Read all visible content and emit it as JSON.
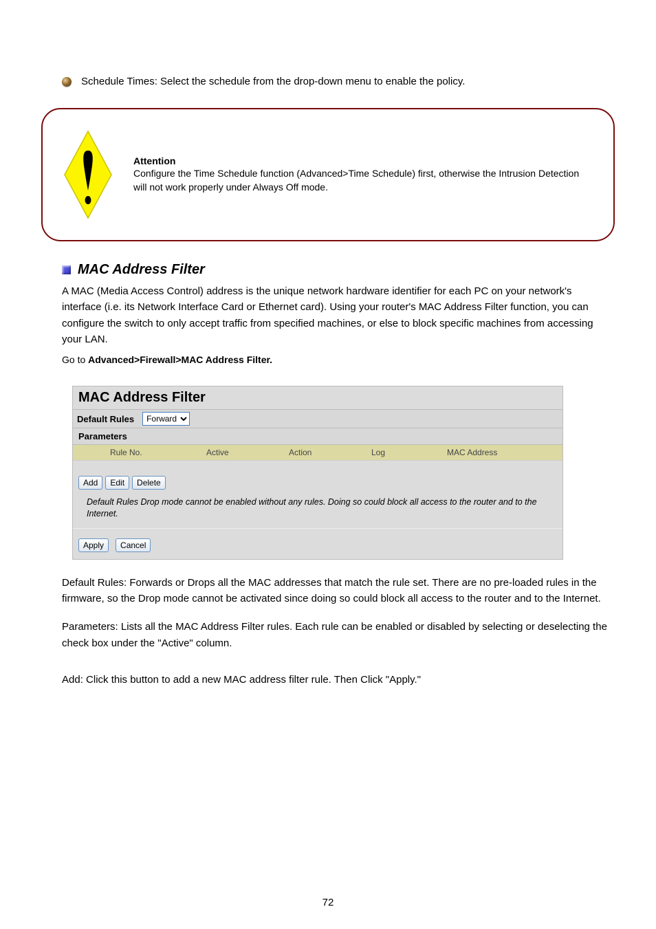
{
  "bullet": {
    "text": "Schedule Times: Select the schedule from the drop-down menu to enable the policy."
  },
  "warning": {
    "label": "Attention",
    "body": "Configure the Time Schedule function (Advanced>Time Schedule) first, otherwise the Intrusion Detection will not work properly under Always Off mode."
  },
  "section": {
    "title": "MAC Address Filter",
    "intro": "A MAC (Media Access Control) address is the unique network hardware identifier for each PC on your network's interface (i.e. its Network Interface Card or Ethernet card). Using your router's MAC Address Filter function, you can configure the switch to only accept traffic from specified machines, or else to block specific machines from accessing your LAN.",
    "path_prefix": "Go to ",
    "path": "Advanced>Firewall>MAC Address Filter."
  },
  "panel": {
    "title": "MAC Address Filter",
    "default_rules_label": "Default Rules",
    "default_rules_value": "Forward",
    "parameters_label": "Parameters",
    "columns": [
      "",
      "Rule No.",
      "Active",
      "Action",
      "Log",
      "MAC Address"
    ],
    "buttons": {
      "add": "Add",
      "edit": "Edit",
      "delete": "Delete"
    },
    "note": "Default Rules Drop mode cannot be enabled without any rules. Doing so could block all access to the router and to the Internet.",
    "apply": "Apply",
    "cancel": "Cancel"
  },
  "desc": {
    "default_rules": "Default Rules: Forwards or Drops all the MAC addresses that match the rule set. There are no pre-loaded rules in the firmware, so the Drop mode cannot be activated since doing so could block all access to the router and to the Internet.",
    "parameters": "Parameters: Lists all the MAC Address Filter rules. Each rule can be enabled or disabled by selecting or deselecting the check box under the \"Active\" column.",
    "add": "Add: Click this button to add a new MAC address filter rule. Then Click \"Apply.\""
  },
  "page_number": "72"
}
